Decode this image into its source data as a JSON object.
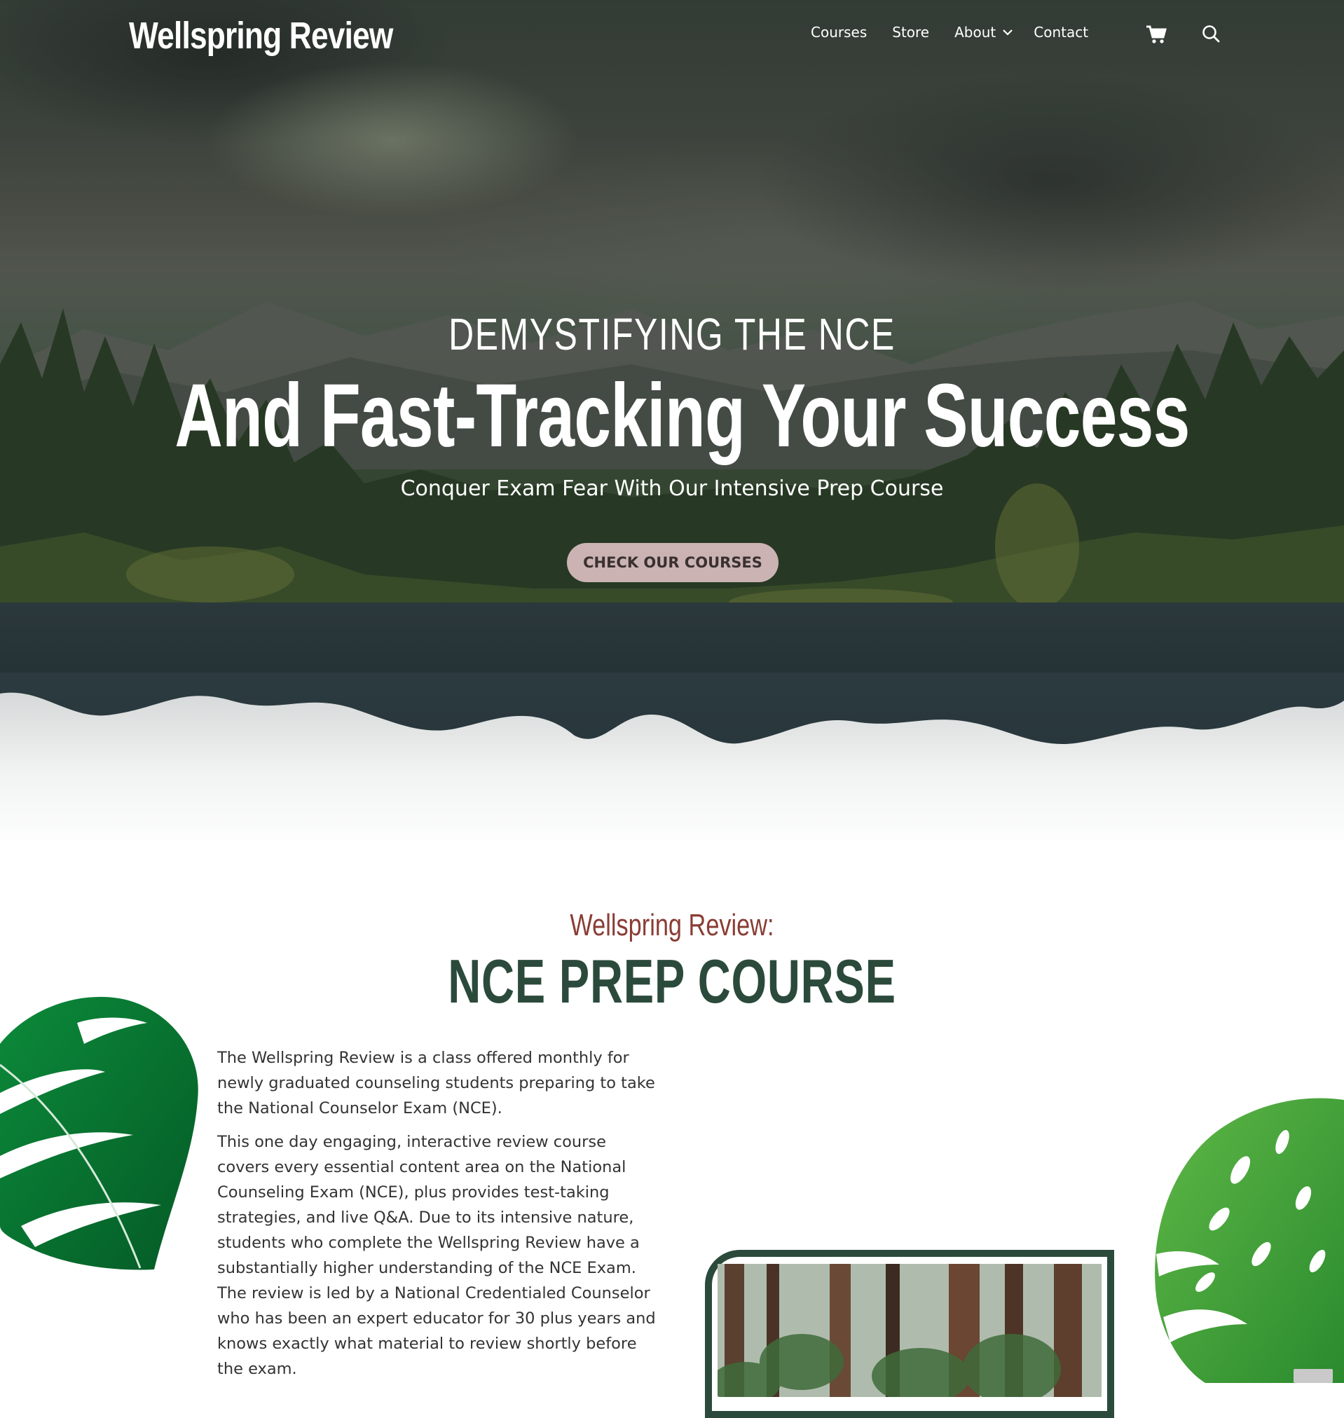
{
  "brand": {
    "name": "Wellspring Review"
  },
  "nav": {
    "items": [
      {
        "label": "Courses"
      },
      {
        "label": "Store"
      },
      {
        "label": "About"
      },
      {
        "label": "Contact"
      }
    ],
    "cart_icon": "cart-icon",
    "search_icon": "search-icon"
  },
  "hero": {
    "eyebrow": "DEMYSTIFYING THE NCE",
    "headline": "And Fast-Tracking Your Success",
    "subline": "Conquer Exam Fear With Our Intensive Prep Course",
    "cta_label": "CHECK OUR COURSES"
  },
  "intro": {
    "kicker": "Wellspring Review:",
    "title": "NCE PREP COURSE",
    "paragraphs": [
      "The Wellspring Review is a class offered monthly for newly graduated counseling students preparing to take the National Counselor Exam (NCE).",
      "This one day engaging, interactive review course covers every essential content area on the National Counseling Exam (NCE), plus provides test-taking strategies, and live Q&A. Due to its intensive nature, students who complete the Wellspring Review have a substantially higher understanding of the NCE Exam. The review is led by a National Credentialed Counselor who has been an expert educator for 30 plus years and knows exactly what material to review shortly before the exam."
    ]
  },
  "colors": {
    "accent_green": "#2b4a3b",
    "kicker_red": "#8a3d35",
    "cta_bg": "#cbb3b4"
  }
}
